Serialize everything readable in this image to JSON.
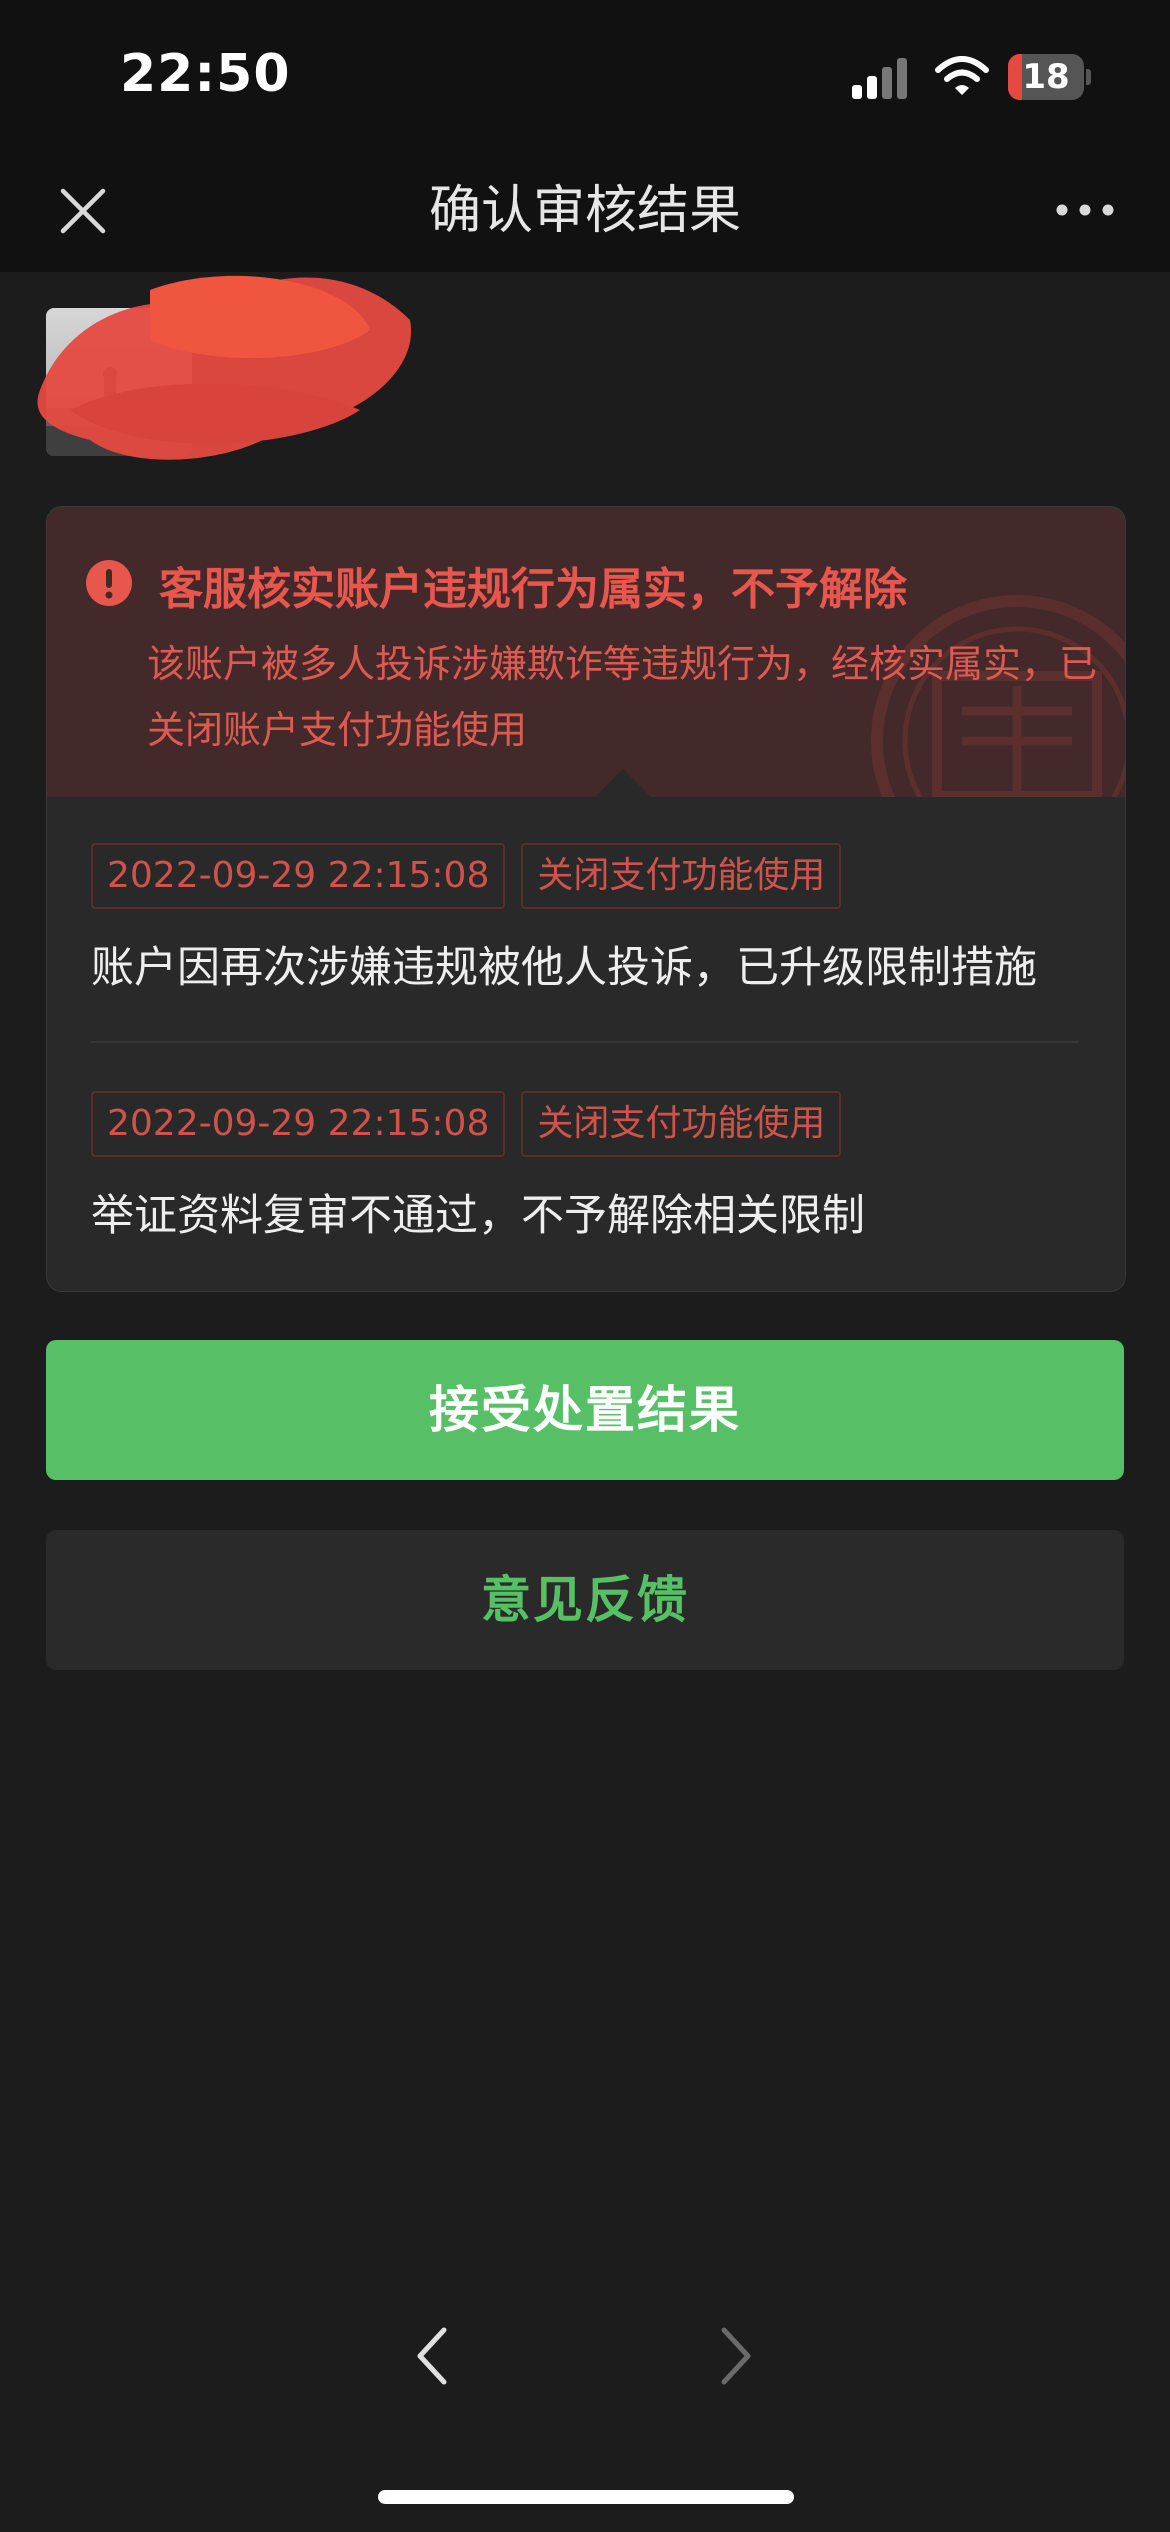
{
  "status_bar": {
    "time": "22:50",
    "battery_text": "18",
    "battery_level": 0.18,
    "battery_color": "#e54a42"
  },
  "nav": {
    "title": "确认审核结果",
    "close_icon": "close-icon",
    "more_icon": "more-dots-icon"
  },
  "alert": {
    "title": "客服核实账户违规行为属实，不予解除",
    "body": "该账户被多人投诉涉嫌欺诈等违规行为，经核实属实，已关闭账户支付功能使用",
    "icon": "exclamation-circle-icon",
    "color": "#e8574d"
  },
  "records": [
    {
      "timestamp": "2022-09-29 22:15:08",
      "tag": "关闭支付功能使用",
      "text": "账户因再次涉嫌违规被他人投诉，已升级限制措施"
    },
    {
      "timestamp": "2022-09-29 22:15:08",
      "tag": "关闭支付功能使用",
      "text": "举证资料复审不通过，不予解除相关限制"
    }
  ],
  "buttons": {
    "accept": "接受处置结果",
    "feedback": "意见反馈",
    "accept_color": "#57c067"
  },
  "bottom_nav": {
    "back_icon": "chevron-left-icon",
    "forward_icon": "chevron-right-icon"
  }
}
